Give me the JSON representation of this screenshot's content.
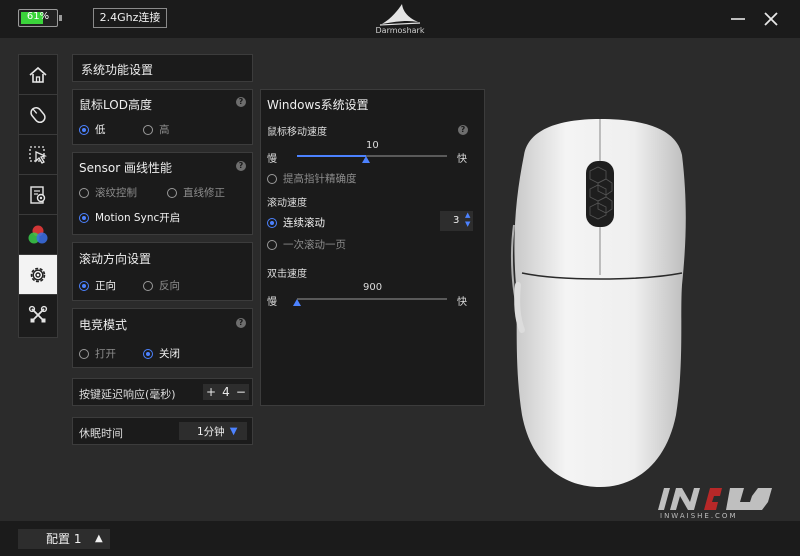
{
  "header": {
    "battery_percent": "61%",
    "battery_level": 0.61,
    "connection": "2.4Ghz连接",
    "brand": "Darmoshark",
    "minimize_icon": "minus-icon",
    "close_icon": "close-icon"
  },
  "nav": {
    "items": [
      {
        "icon": "home-icon",
        "active": false
      },
      {
        "icon": "mouse-button-icon",
        "active": false
      },
      {
        "icon": "cursor-icon",
        "active": false
      },
      {
        "icon": "macro-icon",
        "active": false
      },
      {
        "icon": "rgb-light-icon",
        "active": false
      },
      {
        "icon": "gear-icon",
        "active": true
      },
      {
        "icon": "tools-icon",
        "active": false
      }
    ]
  },
  "system": {
    "title": "系统功能设置",
    "lod": {
      "title": "鼠标LOD高度",
      "help": "?",
      "options": [
        "低",
        "高"
      ],
      "selected": "低"
    },
    "sensor": {
      "title": "Sensor 画线性能",
      "help": "?",
      "options": [
        "滚纹控制",
        "直线修正",
        "Motion Sync开启"
      ],
      "selected": "Motion Sync开启"
    },
    "scroll_dir": {
      "title": "滚动方向设置",
      "options": [
        "正向",
        "反向"
      ],
      "selected": "正向"
    },
    "esports": {
      "title": "电竞模式",
      "help": "?",
      "options": [
        "打开",
        "关闭"
      ],
      "selected": "关闭"
    },
    "debounce": {
      "label": "按键延迟响应(毫秒)",
      "plus": "+",
      "value": "4",
      "minus": "−"
    },
    "sleep": {
      "label": "休眠时间",
      "value": "1分钟",
      "caret": "▼"
    }
  },
  "windows": {
    "title": "Windows系统设置",
    "pointer_speed": {
      "label": "鼠标移动速度",
      "help": "?",
      "value": "10",
      "min_label": "慢",
      "max_label": "快",
      "fraction": 0.46
    },
    "precision": {
      "label": "提高指针精确度",
      "checked": false
    },
    "scroll_speed": {
      "label": "滚动速度",
      "options": [
        "连续滚动",
        "一次滚动一页"
      ],
      "selected": "连续滚动",
      "lines": "3",
      "up": "▲",
      "down": "▼"
    },
    "double_click": {
      "label": "双击速度",
      "value": "900",
      "min_label": "慢",
      "max_label": "快",
      "fraction": 0.0
    }
  },
  "footer": {
    "profile_label": "配置 1",
    "profile_caret": "▲"
  },
  "watermark": {
    "text": "INWAISHE.COM"
  },
  "colors": {
    "accent": "#4c82ff",
    "battery": "#3bd43b",
    "panel": "#1b1b1b",
    "background": "#2b2b2b"
  }
}
